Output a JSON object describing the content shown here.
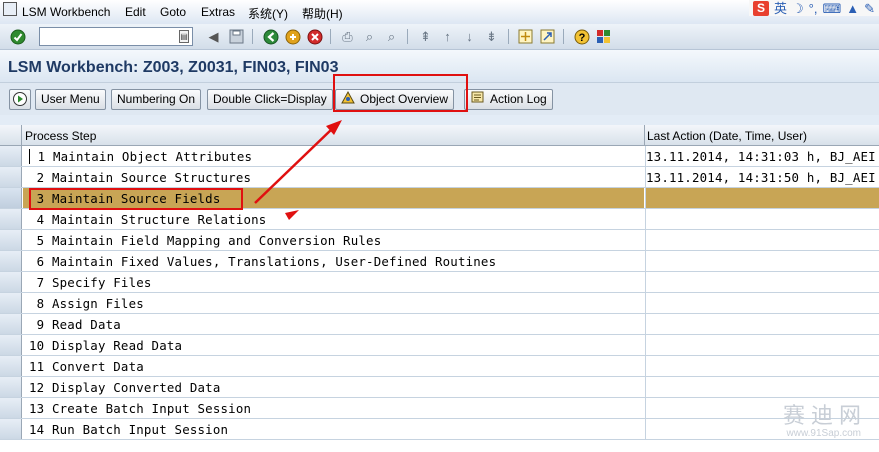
{
  "menu": {
    "items": [
      "LSM Workbench",
      "Edit",
      "Goto",
      "Extras",
      "系统(Y)",
      "帮助(H)"
    ]
  },
  "ime_bar": {
    "logo": "S",
    "mode": "英",
    "icons": [
      "moon-icon",
      "punctuation-icon",
      "keyboard-icon",
      "skin-icon",
      "toolbox-icon"
    ]
  },
  "std_toolbar": {
    "command_value": "",
    "icons": [
      "enter-icon",
      "save-icon",
      "back-icon",
      "exit-icon",
      "cancel-icon",
      "print-icon",
      "find-icon",
      "find-next-icon",
      "first-page-icon",
      "previous-page-icon",
      "next-page-icon",
      "last-page-icon",
      "create-session-icon",
      "shortcut-icon",
      "help-icon",
      "customize-layout-icon"
    ]
  },
  "title": "LSM Workbench: Z003, Z0031, FIN03, FIN03",
  "app_toolbar": {
    "buttons": [
      "User Menu",
      "Numbering On",
      "Double Click=Display",
      "Object Overview",
      "Action Log"
    ]
  },
  "table": {
    "columns": [
      "Process Step",
      "Last Action (Date, Time, User)"
    ],
    "rows": [
      {
        "step": " 1 Maintain Object Attributes",
        "last_action": "13.11.2014, 14:31:03 h, BJ_AEI"
      },
      {
        "step": " 2 Maintain Source Structures",
        "last_action": "13.11.2014, 14:31:50 h, BJ_AEI"
      },
      {
        "step": " 3 Maintain Source Fields",
        "last_action": ""
      },
      {
        "step": " 4 Maintain Structure Relations",
        "last_action": ""
      },
      {
        "step": " 5 Maintain Field Mapping and Conversion Rules",
        "last_action": ""
      },
      {
        "step": " 6 Maintain Fixed Values, Translations, User-Defined Routines",
        "last_action": ""
      },
      {
        "step": " 7 Specify Files",
        "last_action": ""
      },
      {
        "step": " 8 Assign Files",
        "last_action": ""
      },
      {
        "step": " 9 Read Data",
        "last_action": ""
      },
      {
        "step": "10 Display Read Data",
        "last_action": ""
      },
      {
        "step": "11 Convert Data",
        "last_action": ""
      },
      {
        "step": "12 Display Converted Data",
        "last_action": ""
      },
      {
        "step": "13 Create Batch Input Session",
        "last_action": ""
      },
      {
        "step": "14 Run Batch Input Session",
        "last_action": ""
      }
    ],
    "selected_row": 2
  },
  "watermark": {
    "text": "赛迪网",
    "url": "www.91Sap.com"
  },
  "colors": {
    "highlight_row": "#c8a555",
    "annotation_red": "#e01010",
    "title_text": "#1f3a64"
  }
}
